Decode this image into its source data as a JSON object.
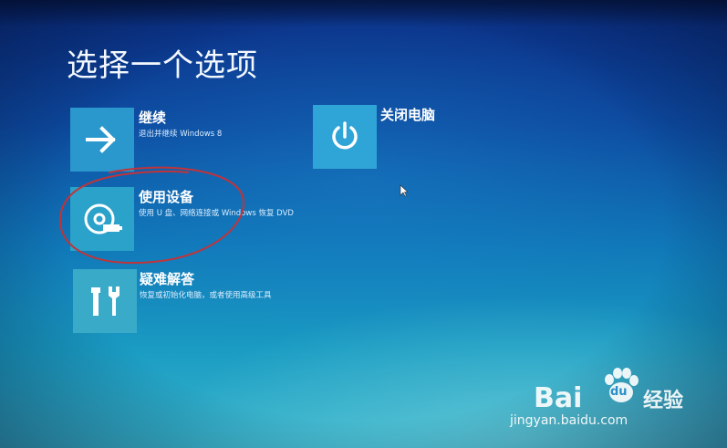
{
  "screen": {
    "title": "选择一个选项"
  },
  "options": [
    {
      "id": "continue",
      "title": "继续",
      "description": "退出并继续 Windows 8",
      "icon": "arrow-right-icon"
    },
    {
      "id": "use-device",
      "title": "使用设备",
      "description": "使用 U 盘、网络连接或 Windows 恢复 DVD",
      "icon": "disc-usb-icon",
      "highlighted": true
    },
    {
      "id": "troubleshoot",
      "title": "疑难解答",
      "description": "恢复或初始化电脑，或者使用高级工具",
      "icon": "tools-icon"
    },
    {
      "id": "shutdown",
      "title": "关闭电脑",
      "icon": "power-icon"
    }
  ],
  "watermark": {
    "brand_left": "Bai",
    "brand_paw": "du",
    "brand_right": "经验",
    "url": "jingyan.baidu.com"
  },
  "colors": {
    "background_top": "#0b2f86",
    "background_bottom": "#3ab6cc",
    "tile": "#2d9fcf",
    "annotation": "#c0343a"
  }
}
